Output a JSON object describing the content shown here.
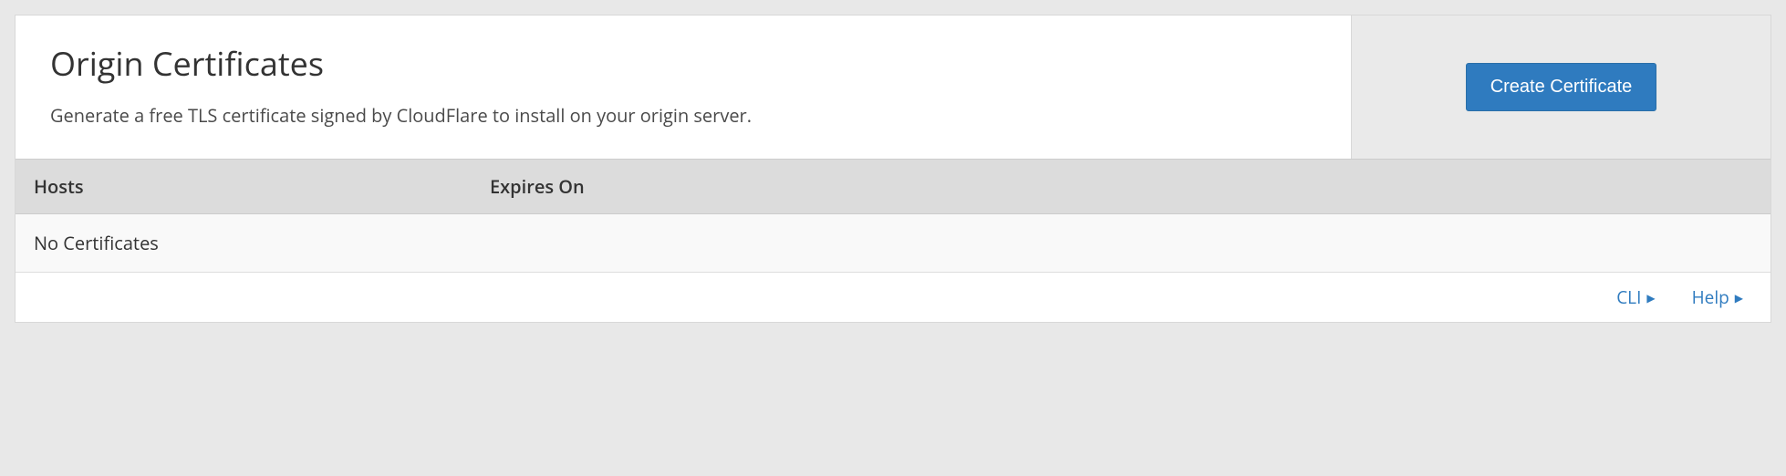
{
  "header": {
    "title": "Origin Certificates",
    "description": "Generate a free TLS certificate signed by CloudFlare to install on your origin server.",
    "create_button": "Create Certificate"
  },
  "table": {
    "columns": {
      "hosts": "Hosts",
      "expires": "Expires On"
    },
    "empty": "No Certificates"
  },
  "footer": {
    "cli": "CLI",
    "help": "Help"
  }
}
